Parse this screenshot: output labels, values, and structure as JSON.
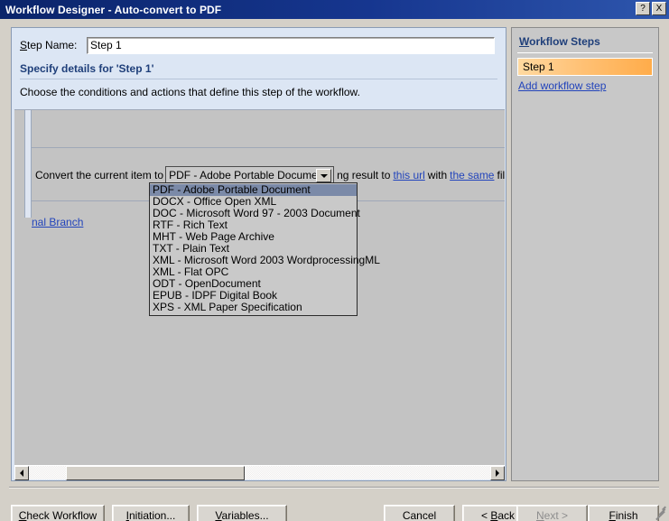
{
  "window": {
    "title": "Workflow Designer - Auto-convert to PDF",
    "help_button": "?",
    "close_button": "X",
    "accent_title_color": "#0a246a"
  },
  "main": {
    "step_name_label_accel": "S",
    "step_name_label_rest": "tep Name:",
    "step_name_value": "Step 1",
    "step_name_placeholder": "Step 1",
    "section_title": "Specify details for 'Step 1'",
    "section_description": "Choose the conditions and actions that define this step of the workflow.",
    "action": {
      "prefix": "Convert the current item to",
      "middle": "ng result to",
      "link_url": "this url",
      "between": "with",
      "link_same": "the same",
      "suffix": "file nam",
      "link_color": "#2244bb"
    },
    "branch_link": "nal Branch"
  },
  "combo": {
    "name": "output-format",
    "selected": "PDF - Adobe Portable Document",
    "arrow_icon": "chevron-down-icon",
    "options": [
      "PDF - Adobe Portable Document",
      "DOCX - Office Open XML",
      "DOC - Microsoft Word 97 - 2003 Document",
      "RTF - Rich Text",
      "MHT - Web Page Archive",
      "TXT - Plain Text",
      "XML - Microsoft Word 2003 WordprocessingML",
      "XML - Flat OPC",
      "ODT - OpenDocument",
      "EPUB - IDPF Digital Book",
      "XPS - XML Paper Specification"
    ],
    "selected_index": 0,
    "highlight_color": "#7b8aa8"
  },
  "scrollbar": {
    "left_arrow_icon": "triangle-left-icon",
    "right_arrow_icon": "triangle-right-icon"
  },
  "sidebar": {
    "title_accel": "W",
    "title_rest": "orkflow Steps",
    "steps": [
      {
        "label": "Step 1",
        "selected": true
      }
    ],
    "add_step_link": "Add workflow step",
    "selected_color": "#ffac4a"
  },
  "footer": {
    "buttons": [
      {
        "accel": "C",
        "pre": "",
        "post": "heck Workflow",
        "name": "check-workflow-button",
        "disabled": false
      },
      {
        "accel": "I",
        "pre": "",
        "post": "nitiation...",
        "name": "initiation-button",
        "disabled": false
      },
      {
        "accel": "V",
        "pre": "",
        "post": "ariables...",
        "name": "variables-button",
        "disabled": false
      },
      {
        "accel": "",
        "pre": "Cancel",
        "post": "",
        "name": "cancel-button",
        "disabled": false
      },
      {
        "accel": "B",
        "pre": "< ",
        "post": "ack",
        "name": "back-button",
        "disabled": false
      },
      {
        "accel": "N",
        "pre": "",
        "post": "ext >",
        "name": "next-button",
        "disabled": true
      },
      {
        "accel": "F",
        "pre": "",
        "post": "inish",
        "name": "finish-button",
        "disabled": false
      }
    ]
  }
}
